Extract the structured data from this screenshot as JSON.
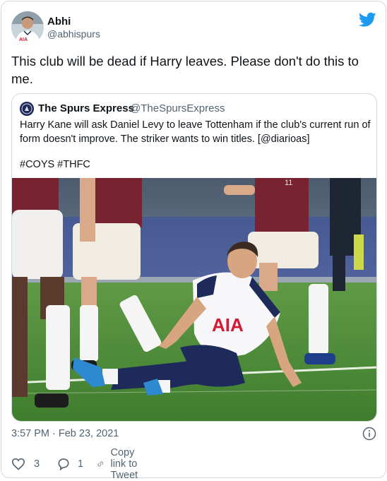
{
  "author": {
    "name": "Abhi",
    "handle": "@abhispurs",
    "avatar_icon": "avatar-icon"
  },
  "brand_icon": "twitter-bird-icon",
  "brand_color": "#1d9bf0",
  "tweet": {
    "text": "This club will be dead if Harry leaves. Please don't do this to me."
  },
  "quoted_tweet": {
    "name": "The Spurs Express",
    "handle": "@TheSpursExpress",
    "logo_icon": "spurs-express-logo",
    "text": "Harry Kane will ask Daniel Levy to leave Tottenham if the club's current run of form doesn't improve. The striker wants to win titles. [@diarioas]",
    "hashtags": "#COYS #THFC",
    "photo": {
      "kit_text": "AIA"
    }
  },
  "timestamp": "3:57 PM · Feb 23, 2021",
  "actions": {
    "likes": "3",
    "replies": "1",
    "copy_link_label": "Copy link to Tweet"
  }
}
